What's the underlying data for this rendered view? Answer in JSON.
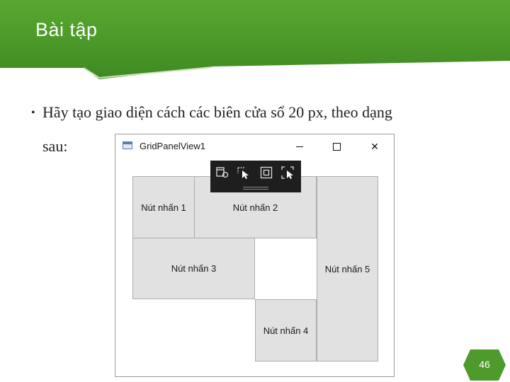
{
  "slide": {
    "title": "Bài tập",
    "bullet_line1": "Hãy tạo giao diện cách các biên cửa sổ 20 px, theo dạng",
    "bullet_line2": "sau:",
    "page_number": "46",
    "accent_color": "#4e9a2c"
  },
  "window": {
    "title": "GridPanelView1",
    "icon": "window-app-icon",
    "controls": [
      "minimize-icon",
      "maximize-icon",
      "close-icon"
    ],
    "close_glyph": "✕"
  },
  "debug_toolbar": {
    "icons": [
      "live-visual-tree-icon",
      "select-element-icon",
      "display-adorners-icon",
      "track-focus-icon"
    ]
  },
  "grid_buttons": {
    "b1": "Nút nhấn 1",
    "b2": "Nút nhấn 2",
    "b3": "Nút nhấn 3",
    "b4": "Nút nhấn 4",
    "b5": "Nút nhấn 5"
  }
}
